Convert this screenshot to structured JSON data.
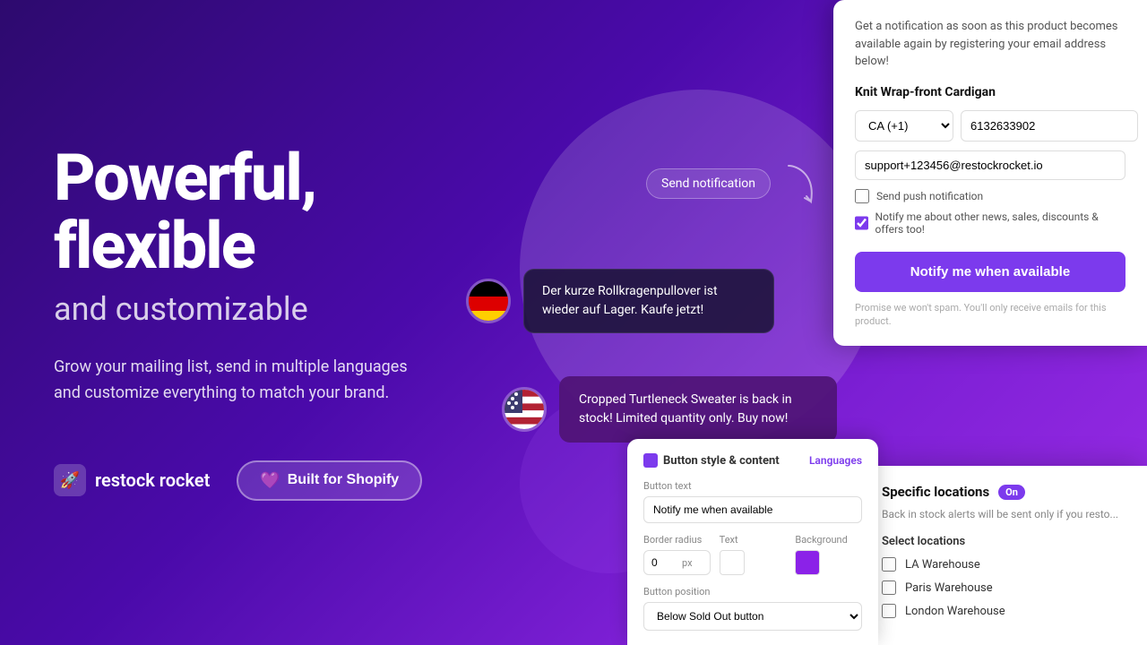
{
  "hero": {
    "title_line1": "Powerful,",
    "title_line2": "flexible",
    "subtitle": "and customizable",
    "description": "Grow your mailing list, send in multiple languages and customize everything to match your brand.",
    "brand_name": "restock rocket",
    "shopify_btn": "Built for Shopify"
  },
  "send_notification_label": "Send notification",
  "notification_panel": {
    "header_text": "Get a notification as soon as this product becomes available again by registering your email address below!",
    "product_name": "Knit Wrap-front Cardigan",
    "phone_country": "CA (+1)",
    "phone_number": "6132633902",
    "email_value": "support+123456@restockrocket.io",
    "push_notification_label": "Send push notification",
    "news_checkbox_label": "Notify me about other news, sales, discounts & offers too!",
    "notify_btn": "Notify me when available",
    "spam_note": "Promise we won't spam. You'll only receive emails for this product."
  },
  "german_bubble": {
    "text": "Der kurze Rollkragenpullover ist wieder auf Lager. Kaufe jetzt!"
  },
  "english_bubble": {
    "text": "Cropped Turtleneck Sweater is back in stock! Limited quantity only. Buy now!"
  },
  "locations_panel": {
    "title": "Specific locations",
    "badge": "On",
    "description": "Back in stock alerts will be sent only if you resto...",
    "select_label": "Select locations",
    "locations": [
      {
        "name": "LA Warehouse",
        "checked": false
      },
      {
        "name": "Paris Warehouse",
        "checked": false
      },
      {
        "name": "London Warehouse",
        "checked": false
      }
    ]
  },
  "button_style_panel": {
    "title": "Button style & content",
    "languages_link": "Languages",
    "button_text_label": "Button text",
    "button_text_value": "Notify me when available",
    "border_radius_label": "Border radius",
    "border_radius_value": "0",
    "border_radius_unit": "px",
    "text_label": "Text",
    "background_label": "Background",
    "background_color": "#8B22E8",
    "position_label": "Button position",
    "position_value": "Below Sold Out button"
  }
}
